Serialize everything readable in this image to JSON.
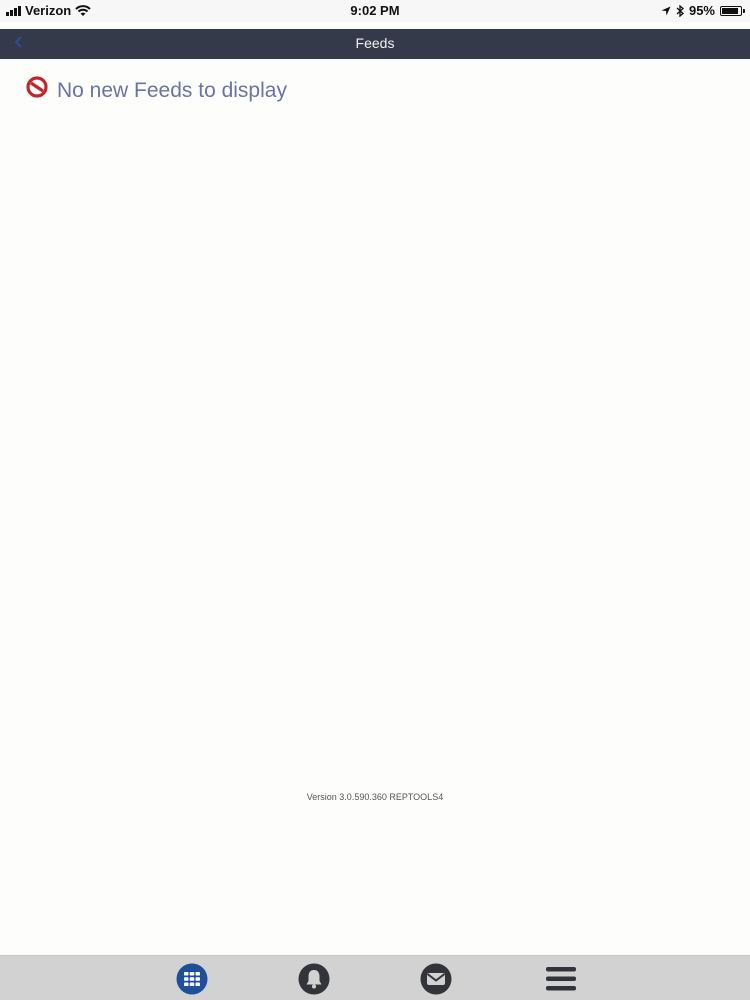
{
  "status_bar": {
    "carrier": "Verizon",
    "time": "9:02 PM",
    "battery_percent": "95%",
    "battery_level": 0.95,
    "icons": [
      "signal-icon",
      "wifi-icon",
      "location-arrow-icon",
      "bluetooth-icon",
      "battery-icon"
    ]
  },
  "nav": {
    "title": "Feeds",
    "back_icon": "back-chevron-icon"
  },
  "content": {
    "empty_icon": "no-entry-icon",
    "empty_message": "No new Feeds to display",
    "version": "Version 3.0.590.360 REPTOOLS4"
  },
  "tab_bar": {
    "items": [
      {
        "icon": "grid-icon",
        "active": true
      },
      {
        "icon": "bell-icon",
        "active": false
      },
      {
        "icon": "mail-icon",
        "active": false
      },
      {
        "icon": "menu-icon",
        "active": false
      }
    ]
  },
  "colors": {
    "nav_background": "#343a4a",
    "accent": "#1f4f9a",
    "empty_text": "#6a73a3",
    "no_entry_red": "#c0262b",
    "tab_bar_background": "#d2d2d2"
  }
}
